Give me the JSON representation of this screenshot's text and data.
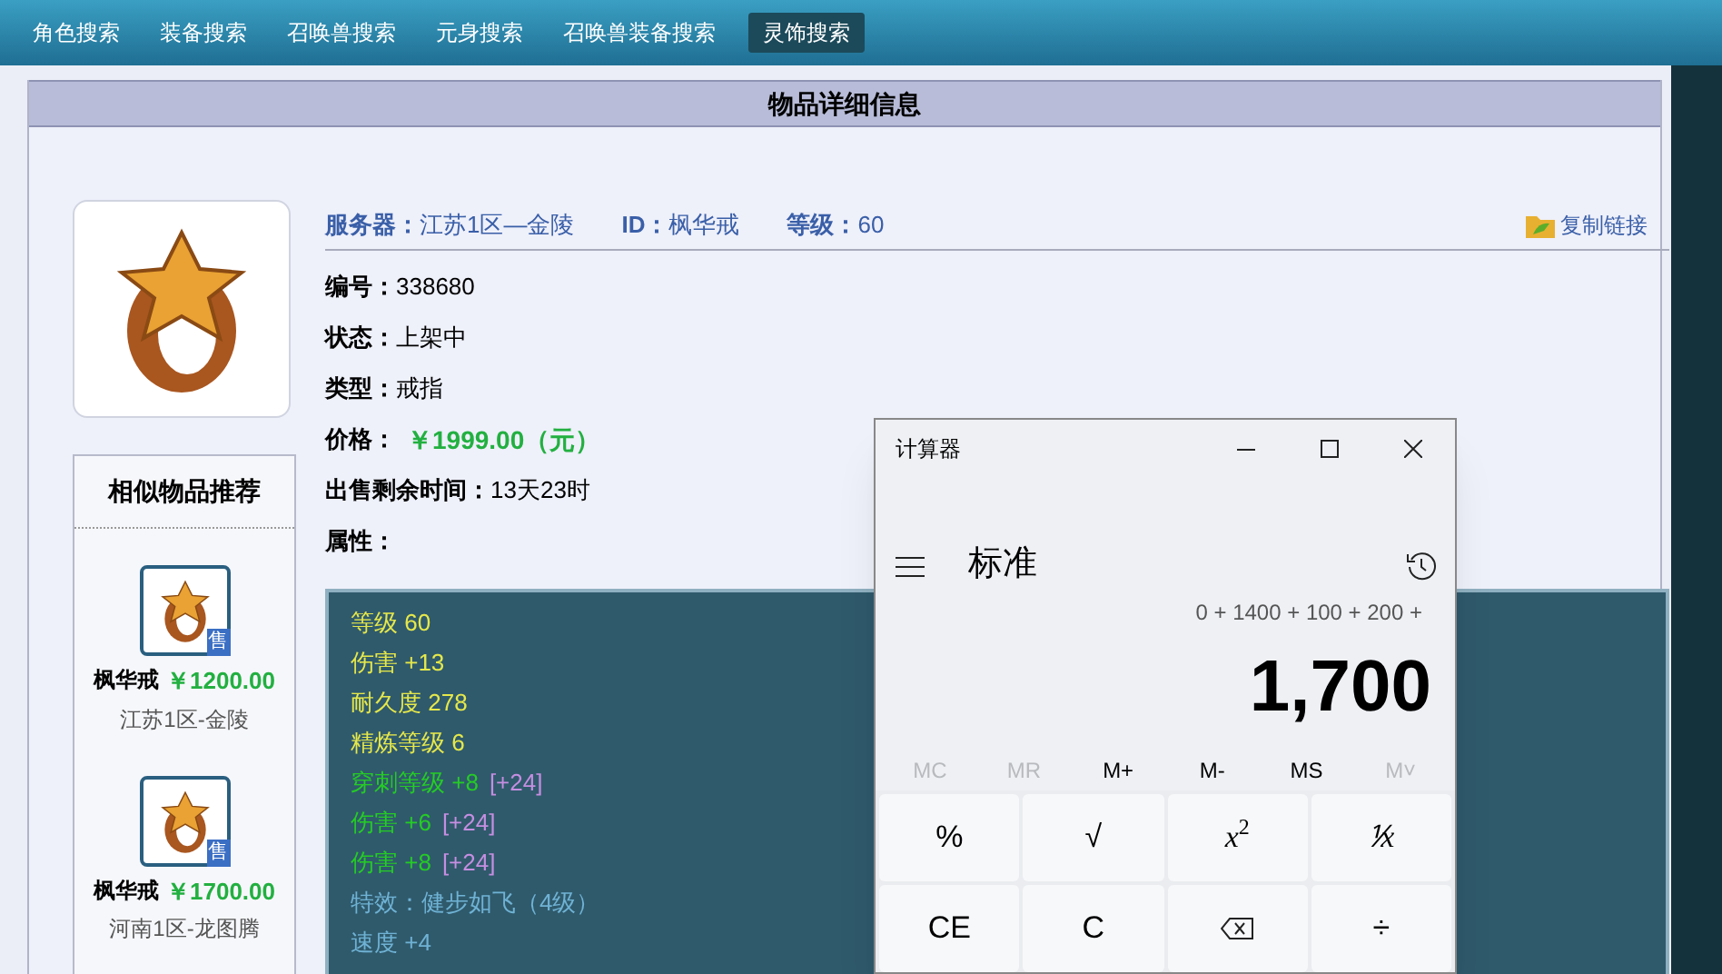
{
  "nav": [
    {
      "label": "角色搜索",
      "selected": false
    },
    {
      "label": "装备搜索",
      "selected": false
    },
    {
      "label": "召唤兽搜索",
      "selected": false
    },
    {
      "label": "元身搜索",
      "selected": false
    },
    {
      "label": "召唤兽装备搜索",
      "selected": false
    },
    {
      "label": "灵饰搜索",
      "selected": true
    }
  ],
  "panel_title": "物品详细信息",
  "summary": [
    {
      "label": "服务器：",
      "value": "江苏1区—金陵"
    },
    {
      "label": "ID：",
      "value": "枫华戒"
    },
    {
      "label": "等级：",
      "value": "60"
    }
  ],
  "copy_link": "复制链接",
  "fields": [
    {
      "label": "编号：",
      "value": "338680",
      "kind": "plain"
    },
    {
      "label": "状态：",
      "value": "上架中",
      "kind": "plain"
    },
    {
      "label": "类型：",
      "value": "戒指",
      "kind": "plain"
    },
    {
      "label": "价格：",
      "value": "￥1999.00（元）",
      "kind": "price"
    },
    {
      "label": "出售剩余时间：",
      "value": "13天23时",
      "kind": "plain"
    },
    {
      "label": "属性："
    }
  ],
  "attributes": [
    {
      "text": "等级 60",
      "kind": "base"
    },
    {
      "text": "伤害 +13",
      "kind": "base"
    },
    {
      "text": "耐久度 278",
      "kind": "base"
    },
    {
      "text": "精炼等级 6",
      "kind": "base"
    },
    {
      "text": "穿刺等级 +8",
      "bonus": "[+24]",
      "kind": "extra"
    },
    {
      "text": "伤害 +6",
      "bonus": "[+24]",
      "kind": "extra"
    },
    {
      "text": "伤害 +8",
      "bonus": "[+24]",
      "kind": "extra"
    },
    {
      "text": "特效：健步如飞（4级）",
      "kind": "effect"
    },
    {
      "text": "速度 +4",
      "kind": "effect"
    }
  ],
  "similar": {
    "title": "相似物品推荐",
    "items": [
      {
        "badge": "售",
        "name": "枫华戒",
        "price": "￥1200.00",
        "server": "江苏1区-金陵"
      },
      {
        "badge": "售",
        "name": "枫华戒",
        "price": "￥1700.00",
        "server": "河南1区-龙图腾"
      }
    ]
  },
  "calculator": {
    "title": "计算器",
    "mode": "标准",
    "expression": "0 + 1400 + 100 + 200 +",
    "result": "1,700",
    "memory": [
      {
        "label": "MC",
        "disabled": true
      },
      {
        "label": "MR",
        "disabled": true
      },
      {
        "label": "M+",
        "disabled": false
      },
      {
        "label": "M-",
        "disabled": false
      },
      {
        "label": "MS",
        "disabled": false
      },
      {
        "label": "M˅",
        "disabled": true
      }
    ],
    "keys": [
      {
        "label": "%",
        "kind": "text"
      },
      {
        "label": "√",
        "kind": "text"
      },
      {
        "label": "x",
        "sup": "2",
        "kind": "power"
      },
      {
        "label": "⅟x",
        "kind": "italic"
      },
      {
        "label": "CE",
        "kind": "text"
      },
      {
        "label": "C",
        "kind": "text"
      },
      {
        "kind": "backspace"
      },
      {
        "label": "÷",
        "kind": "text"
      }
    ]
  }
}
